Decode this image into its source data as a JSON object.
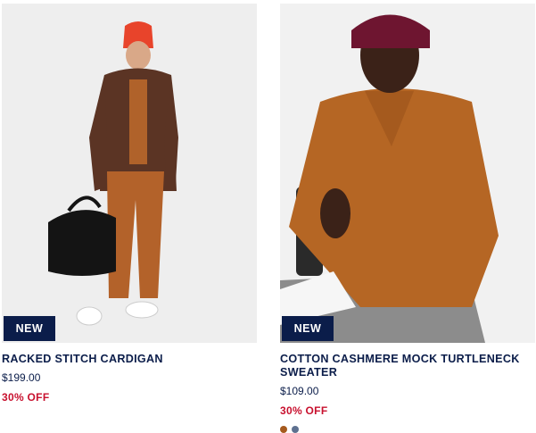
{
  "products": [
    {
      "badge": "NEW",
      "name": "RACKED STITCH CARDIGAN",
      "price": "$199.00",
      "promo": "30% OFF",
      "image_alt": "Model wearing brown cardigan with orange beanie holding black bag"
    },
    {
      "badge": "NEW",
      "name": "COTTON CASHMERE MOCK TURTLENECK SWEATER",
      "price": "$109.00",
      "promo": "30% OFF",
      "image_alt": "Model wearing brown mock turtleneck sweater and burgundy beanie",
      "swatches": [
        {
          "name": "brown",
          "color": "#a55a1e"
        },
        {
          "name": "blue-grey",
          "color": "#5e7190"
        }
      ]
    }
  ],
  "colors": {
    "navy": "#0b1d4a",
    "promo_red": "#c8102e"
  }
}
